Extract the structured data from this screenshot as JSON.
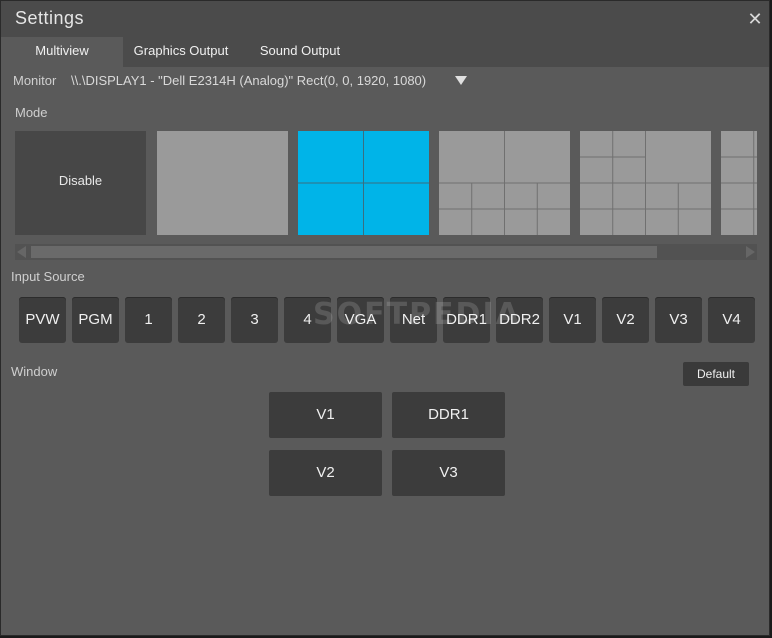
{
  "window": {
    "title": "Settings"
  },
  "tabs": [
    {
      "label": "Multiview",
      "active": true
    },
    {
      "label": "Graphics Output",
      "active": false
    },
    {
      "label": "Sound Output",
      "active": false
    }
  ],
  "monitor": {
    "label": "Monitor",
    "value": "\\\\.\\DISPLAY1 - \"Dell E2314H (Analog)\" Rect(0, 0, 1920, 1080)"
  },
  "mode": {
    "label": "Mode",
    "disable_label": "Disable",
    "selected_color": "#00b4e8",
    "tile_color": "#9a9a9a"
  },
  "input_source": {
    "label": "Input Source",
    "buttons": [
      "PVW",
      "PGM",
      "1",
      "2",
      "3",
      "4",
      "VGA",
      "Net",
      "DDR1",
      "DDR2",
      "V1",
      "V2",
      "V3",
      "V4"
    ]
  },
  "window_section": {
    "label": "Window",
    "default_label": "Default",
    "slots": [
      "V1",
      "DDR1",
      "V2",
      "V3"
    ]
  },
  "watermark": "SOFTPEDIA"
}
